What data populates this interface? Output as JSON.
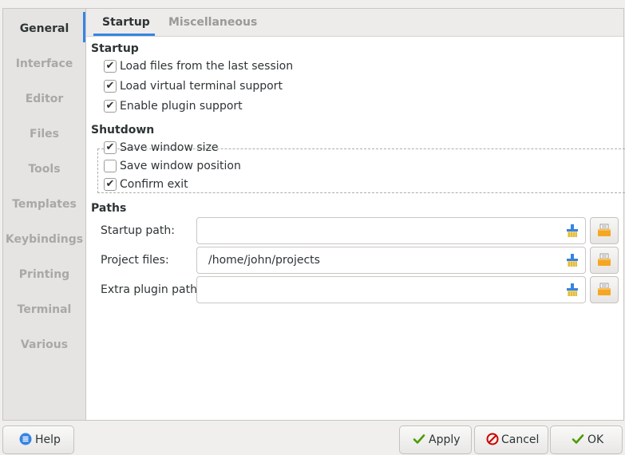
{
  "sidebar": {
    "items": [
      {
        "label": "General",
        "active": true
      },
      {
        "label": "Interface"
      },
      {
        "label": "Editor"
      },
      {
        "label": "Files"
      },
      {
        "label": "Tools"
      },
      {
        "label": "Templates"
      },
      {
        "label": "Keybindings"
      },
      {
        "label": "Printing"
      },
      {
        "label": "Terminal"
      },
      {
        "label": "Various"
      }
    ]
  },
  "tabs": [
    {
      "label": "Startup",
      "active": true
    },
    {
      "label": "Miscellaneous"
    }
  ],
  "startup": {
    "heading": "Startup",
    "options": [
      {
        "label": "Load files from the last session",
        "checked": true
      },
      {
        "label": "Load virtual terminal support",
        "checked": true
      },
      {
        "label": "Enable plugin support",
        "checked": true
      }
    ]
  },
  "shutdown": {
    "heading": "Shutdown",
    "options": [
      {
        "label": "Save window size",
        "checked": true
      },
      {
        "label": "Save window position",
        "checked": false
      },
      {
        "label": "Confirm exit",
        "checked": true
      }
    ]
  },
  "paths": {
    "heading": "Paths",
    "rows": [
      {
        "label": "Startup path:",
        "value": ""
      },
      {
        "label": "Project files:",
        "value": "/home/john/projects"
      },
      {
        "label": "Extra plugin path:",
        "value": ""
      }
    ]
  },
  "buttons": {
    "help": "Help",
    "apply": "Apply",
    "cancel": "Cancel",
    "ok": "OK"
  },
  "colors": {
    "accent": "#3584e4",
    "folder": "#f5a623",
    "check_green": "#4e9a06",
    "cancel_red": "#cc0000",
    "help_blue": "#3584e4"
  },
  "icons": {
    "clear": "edit-clear-icon",
    "folder": "folder-open-icon",
    "help": "help-icon",
    "apply": "checkmark-icon",
    "cancel": "cancel-icon",
    "ok": "checkmark-icon"
  }
}
